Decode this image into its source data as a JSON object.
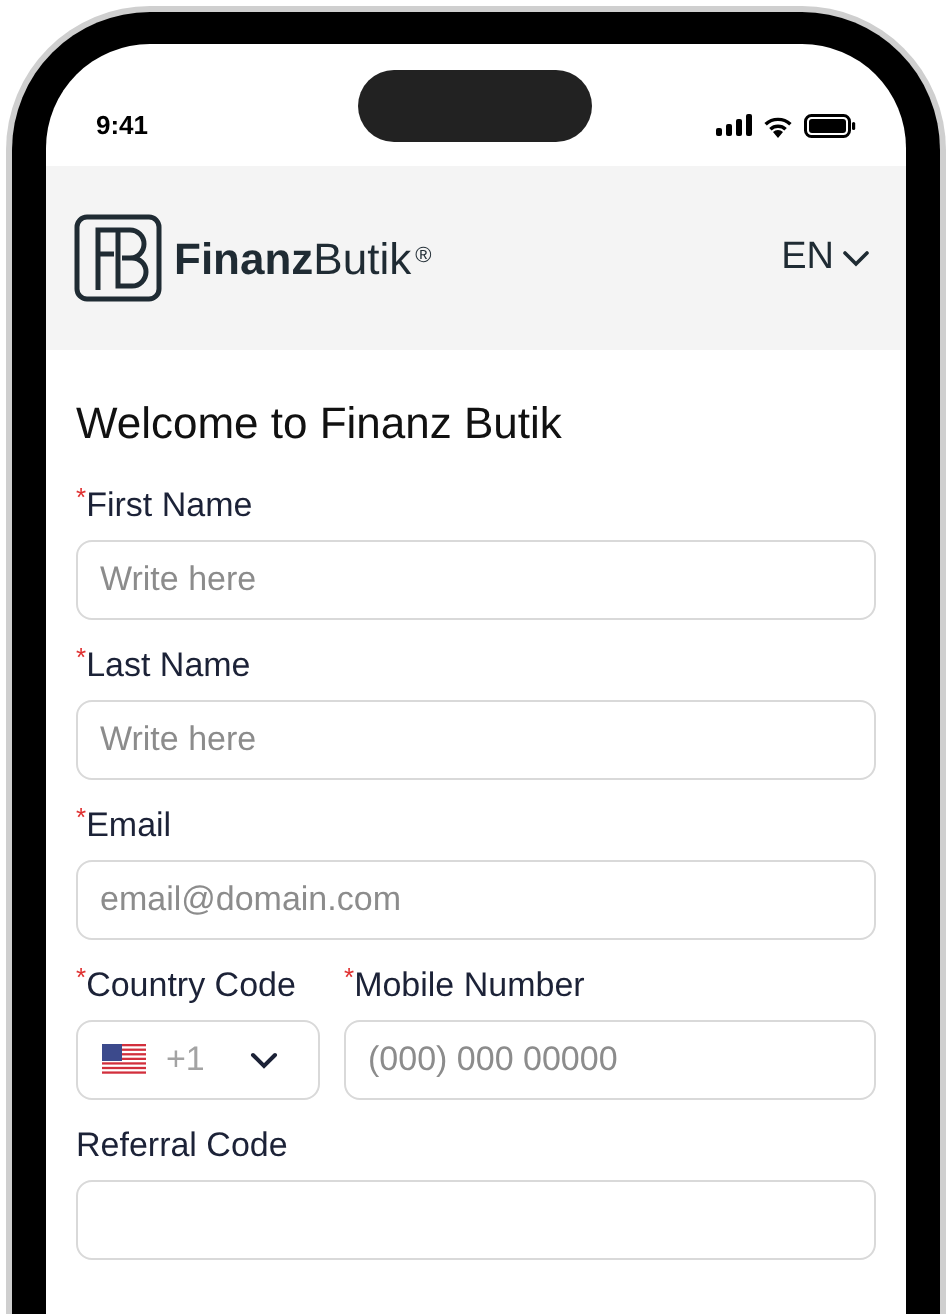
{
  "status_bar": {
    "time": "9:41"
  },
  "header": {
    "brand_bold": "Finanz",
    "brand_light": "Butik",
    "brand_mark": "®",
    "language": "EN"
  },
  "form": {
    "title": "Welcome to Finanz Butik",
    "rows": [
      {
        "fields": [
          {
            "kind": "text",
            "label": "First Name",
            "required_mark": "*",
            "placeholder": "Write here"
          }
        ]
      },
      {
        "fields": [
          {
            "kind": "text",
            "label": "Last Name",
            "required_mark": "*",
            "placeholder": "Write here"
          }
        ]
      },
      {
        "fields": [
          {
            "kind": "text",
            "label": "Email",
            "required_mark": "*",
            "placeholder": "email@domain.com"
          }
        ]
      },
      {
        "fields": [
          {
            "kind": "country",
            "label": "Country Code",
            "required_mark": "*",
            "value": "+1"
          },
          {
            "kind": "text",
            "label": "Mobile Number",
            "required_mark": "*",
            "placeholder": "(000) 000 00000"
          }
        ]
      },
      {
        "fields": [
          {
            "kind": "text",
            "label": "Referral Code"
          }
        ]
      }
    ]
  }
}
